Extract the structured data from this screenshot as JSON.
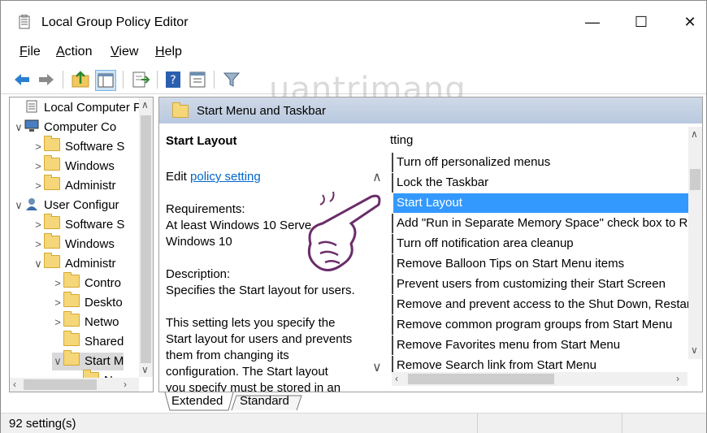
{
  "window": {
    "title": "Local Group Policy Editor"
  },
  "window_buttons": {
    "minimize": "—",
    "maximize": "☐",
    "close": "✕"
  },
  "menu": [
    {
      "key": "F",
      "rest": "ile"
    },
    {
      "key": "A",
      "rest": "ction"
    },
    {
      "key": "V",
      "rest": "iew"
    },
    {
      "key": "H",
      "rest": "elp"
    }
  ],
  "toolbar_icons": [
    "back-arrow-icon",
    "forward-arrow-icon",
    "up-folder-icon",
    "show-hide-tree-icon",
    "export-list-icon",
    "help-icon",
    "properties-icon",
    "filter-icon"
  ],
  "tree": [
    {
      "label": "Local Computer P",
      "indent": 0,
      "exp": "",
      "icon": "policy"
    },
    {
      "label": "Computer Co",
      "indent": 0,
      "exp": "∨",
      "icon": "computer"
    },
    {
      "label": "Software S",
      "indent": 1,
      "exp": ">",
      "icon": "folder"
    },
    {
      "label": "Windows",
      "indent": 1,
      "exp": ">",
      "icon": "folder"
    },
    {
      "label": "Administr",
      "indent": 1,
      "exp": ">",
      "icon": "folder"
    },
    {
      "label": "User Configur",
      "indent": 0,
      "exp": "∨",
      "icon": "user"
    },
    {
      "label": "Software S",
      "indent": 1,
      "exp": ">",
      "icon": "folder"
    },
    {
      "label": "Windows",
      "indent": 1,
      "exp": ">",
      "icon": "folder"
    },
    {
      "label": "Administr",
      "indent": 1,
      "exp": "∨",
      "icon": "folder"
    },
    {
      "label": "Contro",
      "indent": 2,
      "exp": ">",
      "icon": "folder"
    },
    {
      "label": "Deskto",
      "indent": 2,
      "exp": ">",
      "icon": "folder"
    },
    {
      "label": "Netwo",
      "indent": 2,
      "exp": ">",
      "icon": "folder"
    },
    {
      "label": "Shared",
      "indent": 2,
      "exp": "",
      "icon": "folder"
    },
    {
      "label": "Start M",
      "indent": 2,
      "exp": "∨",
      "icon": "folder",
      "selected": true
    },
    {
      "label": "No",
      "indent": 3,
      "exp": "",
      "icon": "folder"
    }
  ],
  "right_header": "Start Menu and Taskbar",
  "detail": {
    "heading": "Start Layout",
    "edit_prefix": "Edit ",
    "edit_link": "policy setting",
    "requirements_label": "Requirements:",
    "requirements_1": "At least Windows 10 Serve",
    "requirements_2": "Windows 10",
    "description_label": "Description:",
    "description_1": "Specifies the Start layout for users.",
    "body_1": "This setting lets you specify the",
    "body_2": "Start layout for users and prevents",
    "body_3": "them from changing its",
    "body_4": "configuration. The Start layout",
    "body_5": "you specify must be stored in an"
  },
  "list": {
    "column_header": "tting",
    "rows": [
      {
        "label": "Turn off personalized menus"
      },
      {
        "label": "Lock the Taskbar"
      },
      {
        "label": "Start Layout",
        "selected": true
      },
      {
        "label": "Add \"Run in Separate Memory Space\" check box to Ru"
      },
      {
        "label": "Turn off notification area cleanup"
      },
      {
        "label": "Remove Balloon Tips on Start Menu items"
      },
      {
        "label": "Prevent users from customizing their Start Screen"
      },
      {
        "label": "Remove and prevent access to the Shut Down, Restart"
      },
      {
        "label": "Remove common program groups from Start Menu"
      },
      {
        "label": "Remove Favorites menu from Start Menu"
      },
      {
        "label": "Remove Search link from Start Menu"
      }
    ]
  },
  "tabs": {
    "extended": "Extended",
    "standard": "Standard"
  },
  "status": {
    "text": "92 setting(s)"
  },
  "watermark": "uantrimang"
}
